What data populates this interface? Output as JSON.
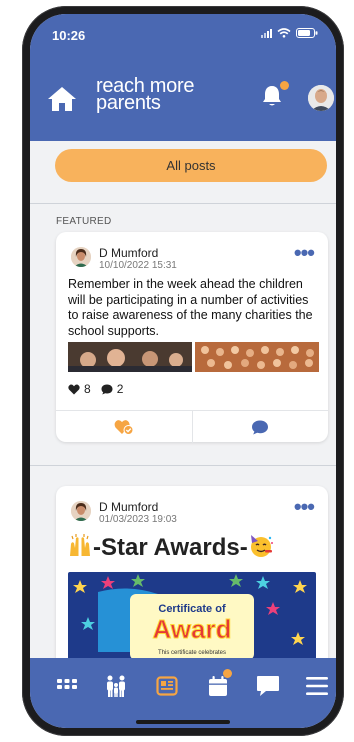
{
  "status_bar": {
    "time": "10:26"
  },
  "header": {
    "brand_line1": "reach more",
    "brand_line2": "parents"
  },
  "filter": {
    "label": "All posts"
  },
  "featured_label": "FEATURED",
  "posts": [
    {
      "author": "D Mumford",
      "date": "10/10/2022 15:31",
      "text": "Remember in the week ahead the children will be participating in a number of activities to raise awareness of the many charities the school supports.",
      "likes": "8",
      "comments": "2"
    },
    {
      "author": "D Mumford",
      "date": "01/03/2023 19:03",
      "title": "-Star Awards-",
      "certificate_title": "Certificate of",
      "certificate_word": "Award",
      "certificate_caption": "This certificate celebrates"
    }
  ],
  "colors": {
    "brand_blue": "#4a68b2",
    "accent_orange": "#f8b25c",
    "badge_orange": "#f6a543"
  },
  "icons": [
    "home-icon",
    "bell-icon",
    "more-icon",
    "heart-icon",
    "comment-icon",
    "apps-icon",
    "family-icon",
    "newsletter-icon",
    "calendar-icon",
    "messages-icon",
    "menu-icon"
  ]
}
